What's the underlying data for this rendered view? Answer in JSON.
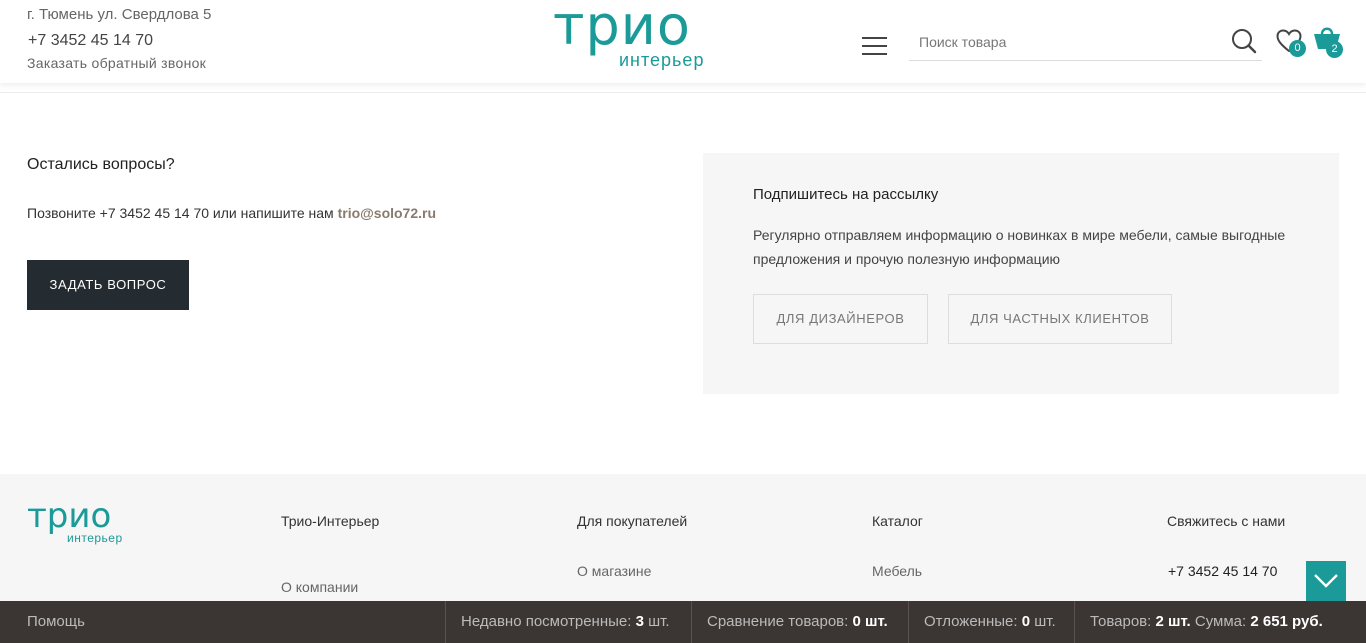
{
  "header": {
    "address": "г. Тюмень ул. Свердлова 5",
    "phone": "+7 3452 45 14 70",
    "callback": "Заказать обратный звонок",
    "logo_main": "трио",
    "logo_sub": "интерьер",
    "search_placeholder": "Поиск товара",
    "wishlist_count": "0",
    "cart_count": "2",
    "accent_color": "#1a9a98"
  },
  "questions": {
    "title": "Остались вопросы?",
    "text_prefix": "Позвоните +7 3452 45 14 70 или напишите нам ",
    "email": "trio@solo72.ru",
    "button": "ЗАДАТЬ ВОПРОС"
  },
  "subscribe": {
    "title": "Подпишитесь на рассылку",
    "text": "Регулярно отправляем информацию о новинках в мире мебели, самые выгодные предложения и прочую полезную информацию",
    "btn_designers": "ДЛЯ ДИЗАЙНЕРОВ",
    "btn_clients": "ДЛЯ ЧАСТНЫХ КЛИЕНТОВ"
  },
  "footer": {
    "logo_main": "трио",
    "logo_sub": "интерьер",
    "col1_title": "Трио-Интерьер",
    "col1_link": "О компании",
    "col2_title": "Для покупателей",
    "col2_link": "О магазине",
    "col3_title": "Каталог",
    "col3_link": "Мебель",
    "col4_title": "Свяжитесь с нами",
    "col4_phone": "+7 3452 45 14 70"
  },
  "bottombar": {
    "help": "Помощь",
    "recent_label": "Недавно посмотренные:",
    "recent_count": "3",
    "recent_unit": "шт.",
    "compare_label": "Сравнение товаров:",
    "compare_value": "0 шт.",
    "deferred_label": "Отложенные:",
    "deferred_count": "0",
    "deferred_unit": "шт.",
    "cart_label": "Товаров:",
    "cart_value": "2 шт.",
    "sum_label": "Сумма:",
    "sum_value": "2 651 руб."
  }
}
